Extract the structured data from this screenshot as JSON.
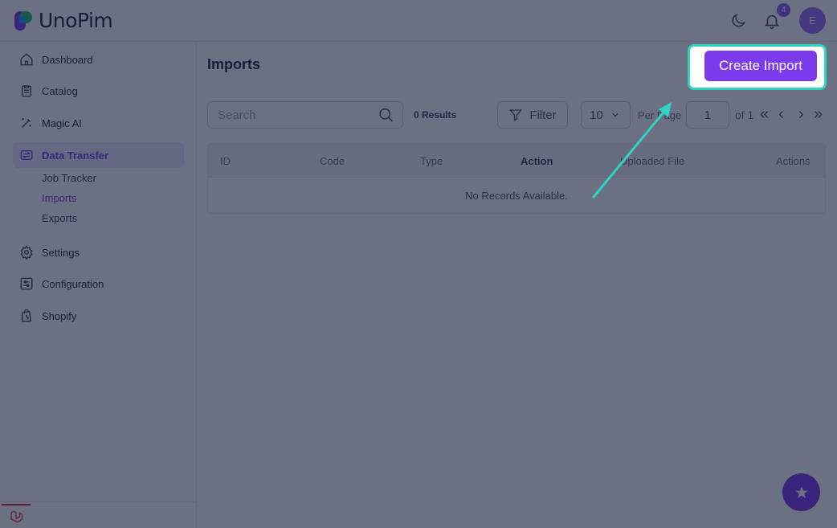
{
  "app": {
    "name": "UnoPim"
  },
  "header": {
    "notification_count": "4",
    "avatar_initial": "E",
    "icons": [
      "moon-icon",
      "bell-icon"
    ]
  },
  "sidebar": {
    "items": [
      {
        "label": "Dashboard",
        "icon": "home-icon"
      },
      {
        "label": "Catalog",
        "icon": "clipboard-icon"
      },
      {
        "label": "Magic AI",
        "icon": "magic-wand-icon"
      },
      {
        "label": "Data Transfer",
        "icon": "transfer-icon",
        "active": true
      },
      {
        "label": "Settings",
        "icon": "gear-icon"
      },
      {
        "label": "Configuration",
        "icon": "sliders-icon"
      },
      {
        "label": "Shopify",
        "icon": "shopify-bag-icon"
      }
    ],
    "sub_items": [
      {
        "label": "Job Tracker"
      },
      {
        "label": "Imports",
        "active": true
      },
      {
        "label": "Exports"
      }
    ]
  },
  "main": {
    "title": "Imports",
    "create_button": "Create Import",
    "search": {
      "placeholder": "Search"
    },
    "results": "0 Results",
    "filter_label": "Filter",
    "per_page": {
      "value": "10",
      "label": "Per Page"
    },
    "pagination": {
      "current": "1",
      "of_label": "of 1"
    },
    "table": {
      "columns": [
        "ID",
        "Code",
        "Type",
        "Action",
        "Uploaded File",
        "Actions"
      ],
      "empty_text": "No Records Available."
    }
  },
  "colors": {
    "accent": "#7c3aed",
    "highlight": "#2dd4bf",
    "overlay": "#111837"
  }
}
